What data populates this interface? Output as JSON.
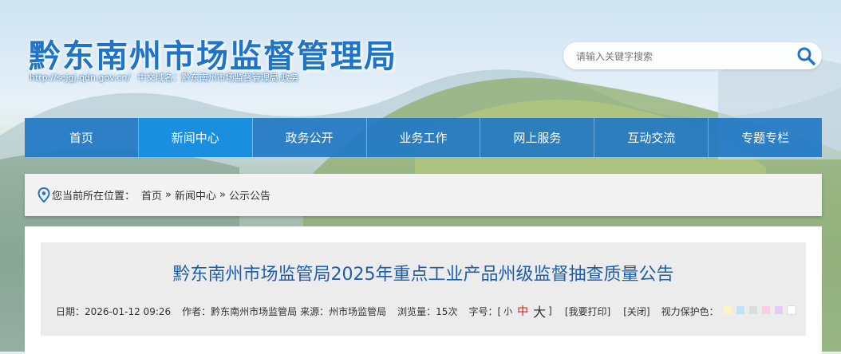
{
  "header": {
    "site_title": "黔东南州市场监督管理局",
    "domain_en": "http://scjgj.qdn.gov.cn/",
    "domain_cn": "中文域名：黔东南州市场监督管理局.政务"
  },
  "search": {
    "placeholder": "请输入关键字搜索",
    "icon": "search-icon"
  },
  "nav": {
    "items": [
      {
        "label": "首页"
      },
      {
        "label": "新闻中心"
      },
      {
        "label": "政务公开"
      },
      {
        "label": "业务工作"
      },
      {
        "label": "网上服务"
      },
      {
        "label": "互动交流"
      },
      {
        "label": "专题专栏"
      }
    ],
    "active_index": 1
  },
  "breadcrumb": {
    "label": "您当前所在位置：",
    "items": [
      "首页",
      "新闻中心",
      "公示公告"
    ],
    "separator": "»"
  },
  "article": {
    "title": "黔东南州市场监管局2025年重点工业产品州级监督抽查质量公告",
    "date": "日期：2026-01-12 09:26",
    "author": "作者：黔东南州市场监管局",
    "source": "来源：州市场监管局",
    "views": "浏览量：15次",
    "font_size_label": "字号：[",
    "font_size_close": "]",
    "font_small": "小",
    "font_medium": "中",
    "font_large": "大",
    "print": "[我要打印]",
    "close": "[关闭]",
    "eye_care_label": "视力保护色：",
    "eye_care_colors": [
      "#fbf4c2",
      "#bfe4f7",
      "#dcdcdc",
      "#f7cfe0",
      "#e2cdf5",
      "#ffffff"
    ]
  },
  "colors": {
    "brand_blue": "#1e74c8",
    "nav_bg": "#2178c4",
    "nav_active": "#1a8fe0",
    "title_blue": "#1f5ea8",
    "font_mid_red": "#d02020"
  }
}
